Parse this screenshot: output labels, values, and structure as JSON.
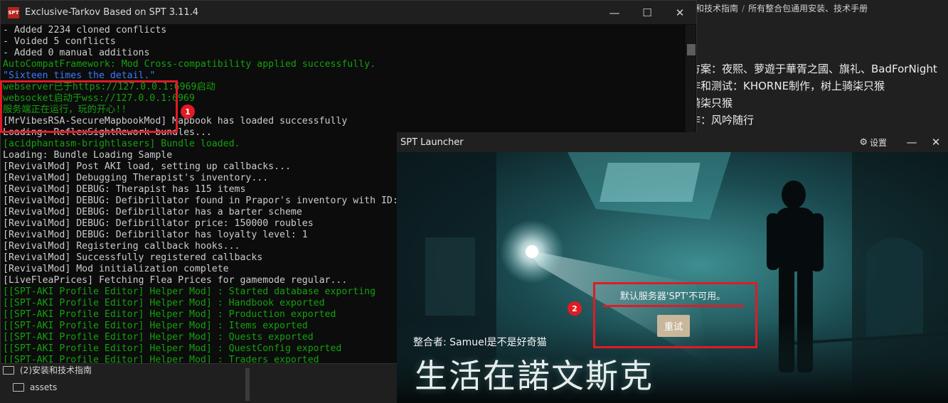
{
  "background_doc": {
    "breadcrumb": [
      "和技术指南",
      "所有整合包通用安装、技术手册"
    ],
    "lines": [
      "?",
      "方案：夜熙、萝遊于華胥之國、旗礼、BadForNight",
      "作和测试：KHORNE制作，树上骑柒只猴",
      "骑柒只猴",
      "作：风吟随行"
    ]
  },
  "explorer": {
    "items": [
      "(2)安装和技术指南",
      "assets"
    ]
  },
  "console": {
    "title": "Exclusive-Tarkov Based on SPT 3.11.4",
    "icon_text": "SPT",
    "lines": [
      {
        "text": "- Added 2234 cloned conflicts",
        "color": "white"
      },
      {
        "text": "- Voided 5 conflicts",
        "color": "white"
      },
      {
        "text": "- Added 0 manual additions",
        "color": "white"
      },
      {
        "text": "AutoCompatFramework: Mod Cross-compatibility applied successfully.",
        "color": "green"
      },
      {
        "text": "\"Sixteen times the detail.\"",
        "color": "blue"
      },
      {
        "text": "webserver已于https://127.0.0.1:6969启动",
        "color": "green"
      },
      {
        "text": "websocket启动于wss://127.0.0.1:6969",
        "color": "green"
      },
      {
        "text": "服务端正在运行，玩的开心!!",
        "color": "green"
      },
      {
        "text": "[MrVibesRSA-SecureMapbookMod] Mapbook has loaded successfully",
        "color": "white"
      },
      {
        "text": "Loading: ReflexSightRework bundles...",
        "color": "white"
      },
      {
        "text": "[acidphantasm-brightlasers] Bundle loaded.",
        "color": "green"
      },
      {
        "text": "Loading: Bundle Loading Sample",
        "color": "white"
      },
      {
        "text": "[RevivalMod] Post AKI load, setting up callbacks...",
        "color": "white"
      },
      {
        "text": "[RevivalMod] Debugging Therapist's inventory...",
        "color": "white"
      },
      {
        "text": "[RevivalMod] DEBUG: Therapist has 115 items",
        "color": "white"
      },
      {
        "text": "[RevivalMod] DEBUG: Defibrillator found in Prapor's inventory with ID:",
        "color": "white"
      },
      {
        "text": "[RevivalMod] DEBUG: Defibrillator has a barter scheme",
        "color": "white"
      },
      {
        "text": "[RevivalMod] DEBUG: Defibrillator price: 150000 roubles",
        "color": "white"
      },
      {
        "text": "[RevivalMod] DEBUG: Defibrillator has loyalty level: 1",
        "color": "white"
      },
      {
        "text": "[RevivalMod] Registering callback hooks...",
        "color": "white"
      },
      {
        "text": "[RevivalMod] Successfully registered callbacks",
        "color": "white"
      },
      {
        "text": "[RevivalMod] Mod initialization complete",
        "color": "white"
      },
      {
        "text": "[LiveFleaPrices] Fetching Flea Prices for gamemode regular...",
        "color": "white"
      },
      {
        "text": "[[SPT-AKI Profile Editor] Helper Mod] : Started database exporting",
        "color": "green"
      },
      {
        "text": "[[SPT-AKI Profile Editor] Helper Mod] : Handbook exported",
        "color": "green"
      },
      {
        "text": "[[SPT-AKI Profile Editor] Helper Mod] : Production exported",
        "color": "green"
      },
      {
        "text": "[[SPT-AKI Profile Editor] Helper Mod] : Items exported",
        "color": "green"
      },
      {
        "text": "[[SPT-AKI Profile Editor] Helper Mod] : Quests exported",
        "color": "green"
      },
      {
        "text": "[[SPT-AKI Profile Editor] Helper Mod] : QuestConfig exported",
        "color": "green"
      },
      {
        "text": "[[SPT-AKI Profile Editor] Helper Mod] : Traders exported",
        "color": "green"
      }
    ]
  },
  "annotations": {
    "badge1": "1",
    "badge2": "2"
  },
  "launcher": {
    "title": "SPT Launcher",
    "settings_label": "设置",
    "error_message": "默认服务器'SPT'不可用。",
    "retry_label": "重试",
    "credit": "整合者: Samuel是不是好奇猫",
    "game_title": "生活在諾文斯克"
  },
  "colors": {
    "console_green": "#13a10e",
    "console_blue": "#3b78ff",
    "console_white": "#cccccc",
    "annotation_red": "#e01b24",
    "retry_button": "#c9b79c"
  }
}
